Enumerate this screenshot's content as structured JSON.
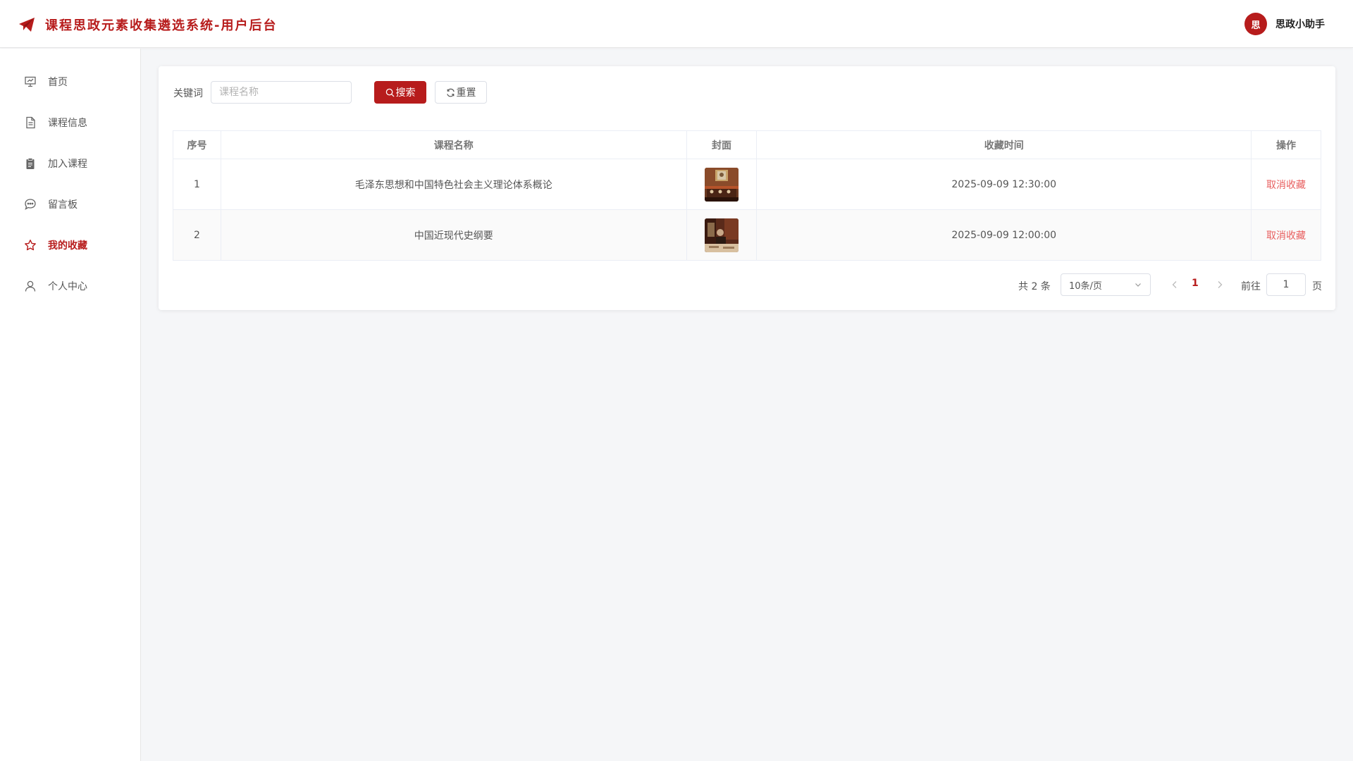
{
  "header": {
    "logo_icon": "paper-plane-icon",
    "title": "课程思政元素收集遴选系统-用户后台",
    "user": {
      "avatar_text": "思",
      "name": "思政小助手"
    }
  },
  "sidebar": {
    "items": [
      {
        "label": "首页",
        "icon": "presentation-icon",
        "active": false
      },
      {
        "label": "课程信息",
        "icon": "document-icon",
        "active": false
      },
      {
        "label": "加入课程",
        "icon": "clipboard-icon",
        "active": false
      },
      {
        "label": "留言板",
        "icon": "chat-icon",
        "active": false
      },
      {
        "label": "我的收藏",
        "icon": "star-icon",
        "active": true
      },
      {
        "label": "个人中心",
        "icon": "user-icon",
        "active": false
      }
    ]
  },
  "filter": {
    "label": "关键词",
    "placeholder": "课程名称",
    "search_label": "搜索",
    "reset_label": "重置"
  },
  "table": {
    "columns": [
      "序号",
      "课程名称",
      "封面",
      "收藏时间",
      "操作"
    ],
    "rows": [
      {
        "index": "1",
        "name": "毛泽东思想和中国特色社会主义理论体系概论",
        "time": "2025-09-09 12:30:00",
        "action": "取消收藏"
      },
      {
        "index": "2",
        "name": "中国近现代史纲要",
        "time": "2025-09-09 12:00:00",
        "action": "取消收藏"
      }
    ]
  },
  "pagination": {
    "total": "共 2 条",
    "page_size": "10条/页",
    "current_page": "1",
    "goto_label": "前往",
    "goto_value": "1",
    "page_suffix": "页"
  },
  "colors": {
    "accent": "#b71c1c",
    "link": "#e85f5f"
  }
}
